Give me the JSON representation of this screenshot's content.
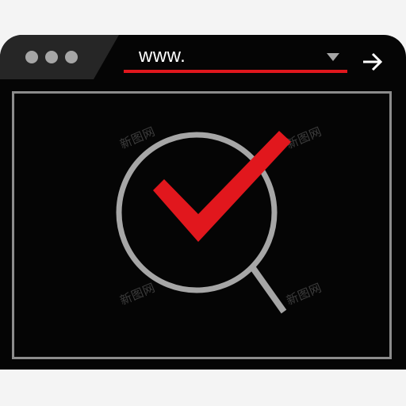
{
  "browser": {
    "address_text": "www.",
    "accent_color": "#e1171d",
    "window_color": "#050505",
    "frame_color": "#8c8c8c"
  },
  "icons": {
    "window_controls": "three-dots",
    "dropdown": "triangle-down-icon",
    "go": "arrow-right-icon",
    "center": "magnifier-check-icon"
  },
  "watermark": {
    "text": "新图网"
  }
}
